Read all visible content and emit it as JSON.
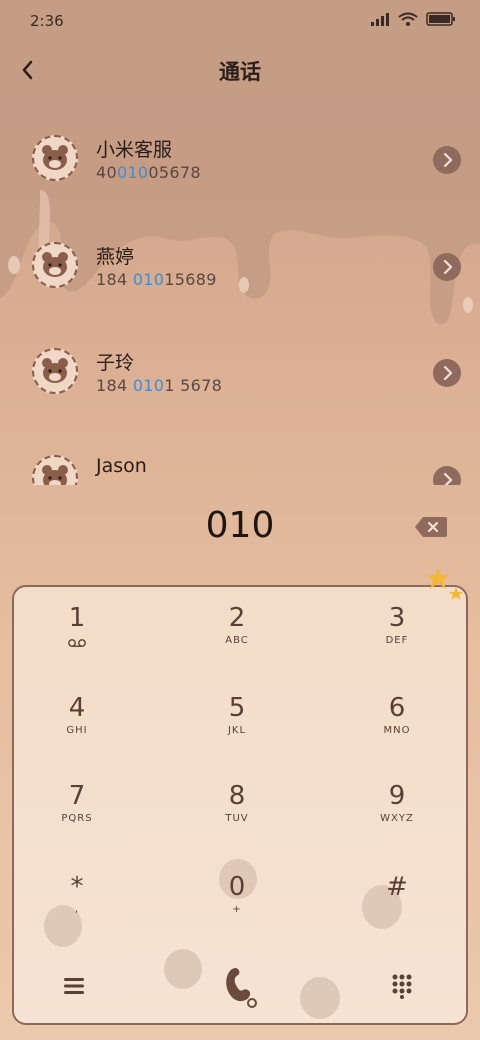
{
  "status": {
    "time": "2:36"
  },
  "header": {
    "title": "通话"
  },
  "contacts": [
    {
      "name": "小米客服",
      "num_pre": "40",
      "num_hl": "010",
      "num_post": "05678"
    },
    {
      "name": "燕婷",
      "num_pre": "184 ",
      "num_hl": "010",
      "num_post": "15689"
    },
    {
      "name": "子玲",
      "num_pre": "184 ",
      "num_hl": "010",
      "num_post": "1 5678"
    },
    {
      "name": "Jason",
      "num_pre": "",
      "num_hl": "",
      "num_post": ""
    }
  ],
  "dial": {
    "input": "010"
  },
  "keys": [
    {
      "digit": "1",
      "letters": ""
    },
    {
      "digit": "2",
      "letters": "ABC"
    },
    {
      "digit": "3",
      "letters": "DEF"
    },
    {
      "digit": "4",
      "letters": "GHI"
    },
    {
      "digit": "5",
      "letters": "JKL"
    },
    {
      "digit": "6",
      "letters": "MNO"
    },
    {
      "digit": "7",
      "letters": "PQRS"
    },
    {
      "digit": "8",
      "letters": "TUV"
    },
    {
      "digit": "9",
      "letters": "WXYZ"
    },
    {
      "digit": "*",
      "letters": ","
    },
    {
      "digit": "0",
      "letters": "+"
    },
    {
      "digit": "#",
      "letters": ""
    }
  ],
  "icons": {
    "back": "chevron-left-icon",
    "arrow": "chevron-right-circle-icon",
    "backspace": "backspace-icon",
    "menu": "menu-icon",
    "call": "phone-call-icon",
    "keypad": "keypad-icon",
    "voicemail": "voicemail-icon"
  }
}
